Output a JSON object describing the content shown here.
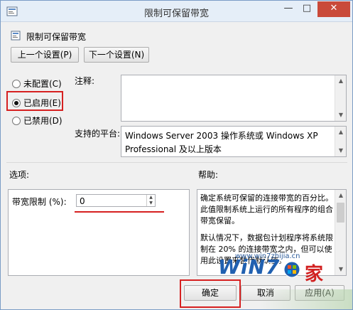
{
  "window": {
    "title": "限制可保留带宽",
    "min_glyph": "—",
    "max_glyph": "□",
    "close_glyph": "✕"
  },
  "policy": {
    "name": "限制可保留带宽"
  },
  "nav": {
    "prev_label": "上一个设置(P)",
    "next_label": "下一个设置(N)"
  },
  "state": {
    "not_configured": "未配置(C)",
    "enabled": "已启用(E)",
    "disabled": "已禁用(D)",
    "selected": "enabled"
  },
  "comment": {
    "label": "注释:",
    "value": ""
  },
  "platform": {
    "label": "支持的平台:",
    "value": "Windows Server 2003 操作系统或 Windows XP Professional 及以上版本"
  },
  "options": {
    "label": "选项:",
    "bandwidth_label": "带宽限制 (%):",
    "bandwidth_value": "0"
  },
  "help": {
    "label": "帮助:",
    "paragraph1": "确定系统可保留的连接带宽的百分比。此值限制系统上运行的所有程序的组合带宽保留。",
    "paragraph2": "默认情况下，数据包计划程序将系统限制在 20% 的连接带宽之内，但可以使用此设置来替代默认值。"
  },
  "footer": {
    "ok_label": "确定",
    "cancel_label": "取消",
    "apply_label": "应用(A)"
  },
  "watermark": {
    "brand": "WiN7",
    "home": "家",
    "url": "www.win7zhijia.cn"
  },
  "colors": {
    "highlight_red": "#d62020",
    "title_bar": "#e5eef8",
    "window_bg": "#f0f0f0"
  }
}
